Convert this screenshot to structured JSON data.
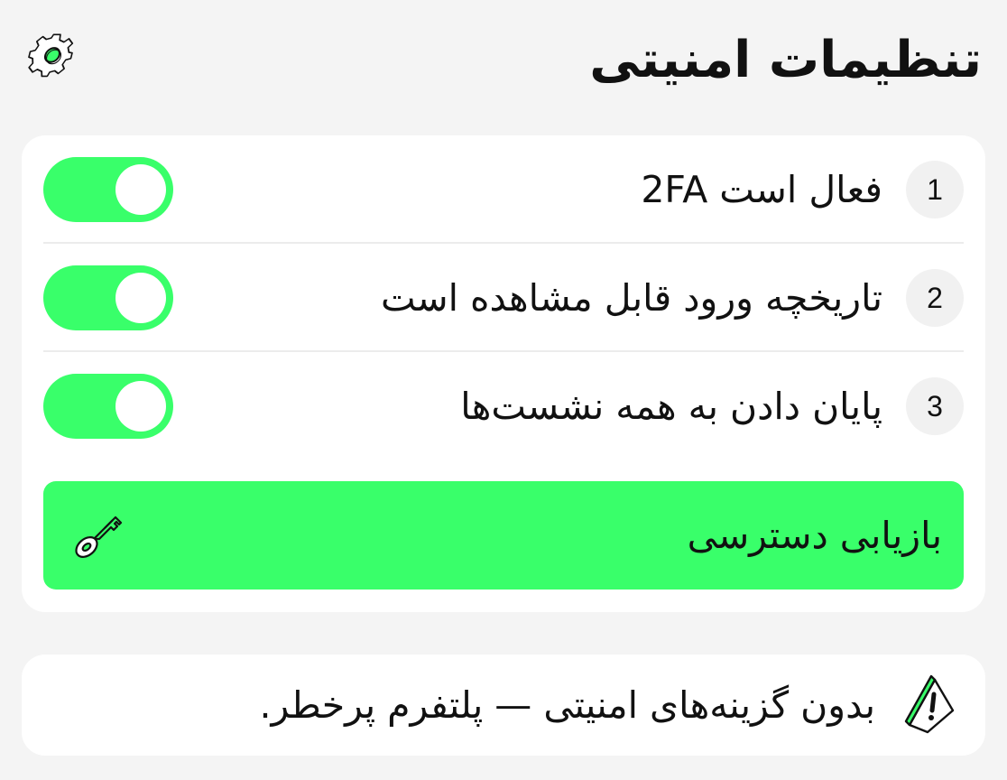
{
  "header": {
    "title": "تنظیمات امنیتی",
    "settings_icon": "gear-icon"
  },
  "settings": {
    "items": [
      {
        "number": "1",
        "label": "فعال است 2FA",
        "enabled": true
      },
      {
        "number": "2",
        "label": "تاریخچه ورود قابل مشاهده است",
        "enabled": true
      },
      {
        "number": "3",
        "label": "پایان دادن به همه نشست‌ها",
        "enabled": true
      }
    ],
    "recovery": {
      "label": "بازیابی دسترسی",
      "icon": "key-icon"
    }
  },
  "warning": {
    "text": "بدون گزینه‌های امنیتی — پلتفرم پرخطر.",
    "icon": "warning-icon"
  },
  "colors": {
    "accent": "#39ff6a",
    "background": "#f4f4f4",
    "card": "#ffffff",
    "text": "#111111"
  }
}
